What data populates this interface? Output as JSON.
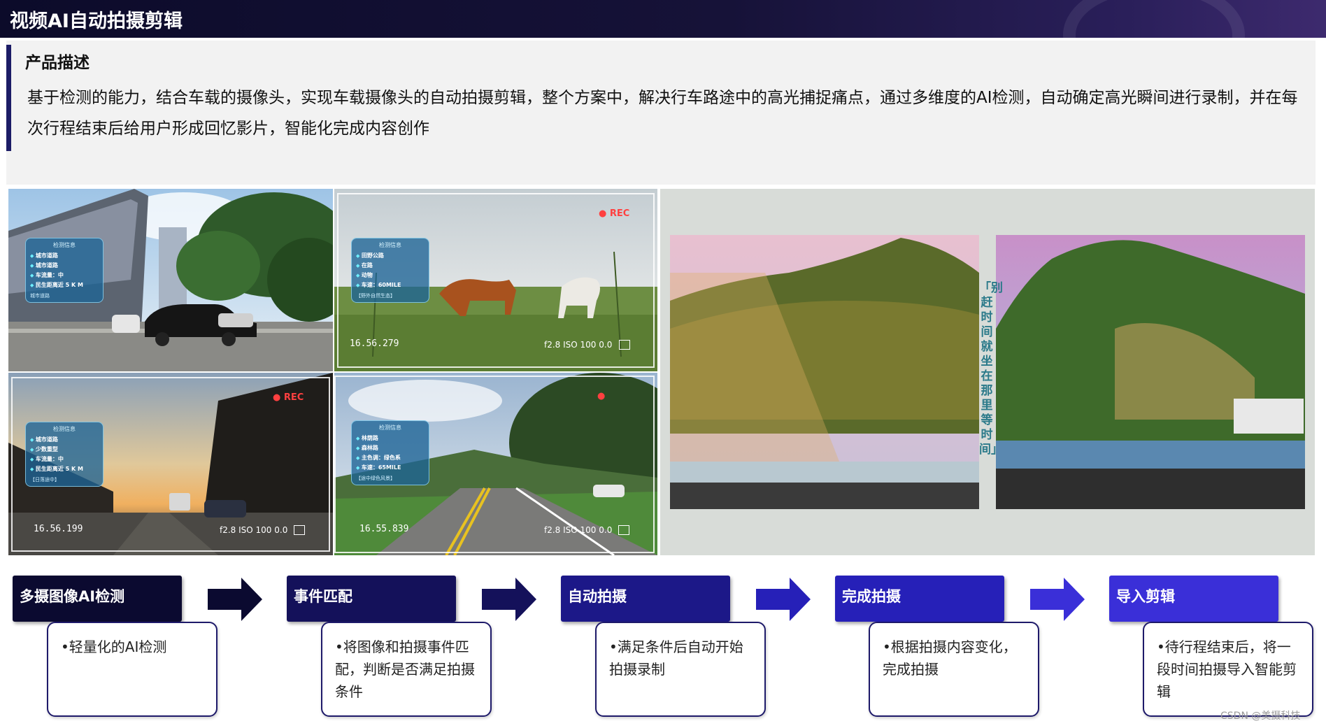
{
  "header": {
    "title": "视频AI自动拍摄剪辑"
  },
  "description": {
    "heading": "产品描述",
    "body": "基于检测的能力，结合车载的摄像头，实现车载摄像头的自动拍摄剪辑，整个方案中，解决行车路途中的高光捕捉痛点，通过多维度的AI检测，自动确定高光瞬间进行录制，并在每次行程结束后给用户形成回忆影片，智能化完成内容创作"
  },
  "photos": [
    {
      "overlay_title": "检测信息",
      "overlay_rows": [
        "城市道路",
        "城市道路",
        "车流量：中",
        "民生距离近 5 K M"
      ],
      "overlay_foot": "城市道路"
    },
    {
      "rec": "REC",
      "overlay_title": "检测信息",
      "overlay_rows": [
        "田野公路",
        "在路",
        "动物",
        "车速：60MILE"
      ],
      "overlay_foot": "【野外自然生态】",
      "timestamp": "16.56.279",
      "camera": "f2.8 ISO 100 0.0"
    },
    {
      "rec": "REC",
      "overlay_title": "检测信息",
      "overlay_rows": [
        "城市道路",
        "少数重型",
        "车流量：中",
        "民生距离近 5 K M"
      ],
      "overlay_foot": "【日落途中】",
      "timestamp": "16.56.199",
      "camera": "f2.8 ISO 100 0.0"
    },
    {
      "overlay_title": "检测信息",
      "overlay_rows": [
        "林荫路",
        "森林路",
        "主色调：绿色系",
        "车速：65MILE"
      ],
      "overlay_foot": "【途中绿色风景】",
      "timestamp": "16.55.839",
      "camera": "f2.8 ISO 100 0.0"
    }
  ],
  "vertical_caption": "「别赶时间 就坐在那里等时间」",
  "steps": [
    {
      "title": "多摄图像AI检测",
      "note": "•轻量化的AI检测",
      "color": "#0b0a30"
    },
    {
      "title": "事件匹配",
      "note": "•将图像和拍摄事件匹配，判断是否满足拍摄条件",
      "color": "#14115a"
    },
    {
      "title": "自动拍摄",
      "note": "•满足条件后自动开始拍摄录制",
      "color": "#1c1888"
    },
    {
      "title": "完成拍摄",
      "note": "•根据拍摄内容变化，完成拍摄",
      "color": "#2620b8"
    },
    {
      "title": "导入剪辑",
      "note": "•待行程结束后，将一段时间拍摄导入智能剪辑",
      "color": "#3a2fd8"
    }
  ],
  "watermark": "CSDN @美摄科技"
}
